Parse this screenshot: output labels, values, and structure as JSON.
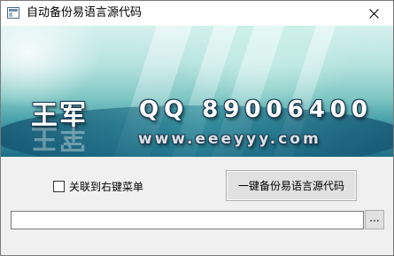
{
  "window": {
    "title": "自动备份易语言源代码"
  },
  "banner": {
    "author": "王军",
    "qq": "QQ 89006400",
    "website": "www.eeeyyy.com"
  },
  "options": {
    "context_menu_label": "关联到右键菜单",
    "context_menu_checked": false
  },
  "actions": {
    "backup_button_label": "一键备份易语言源代码",
    "browse_button_label": "..."
  },
  "path_field": {
    "value": ""
  }
}
